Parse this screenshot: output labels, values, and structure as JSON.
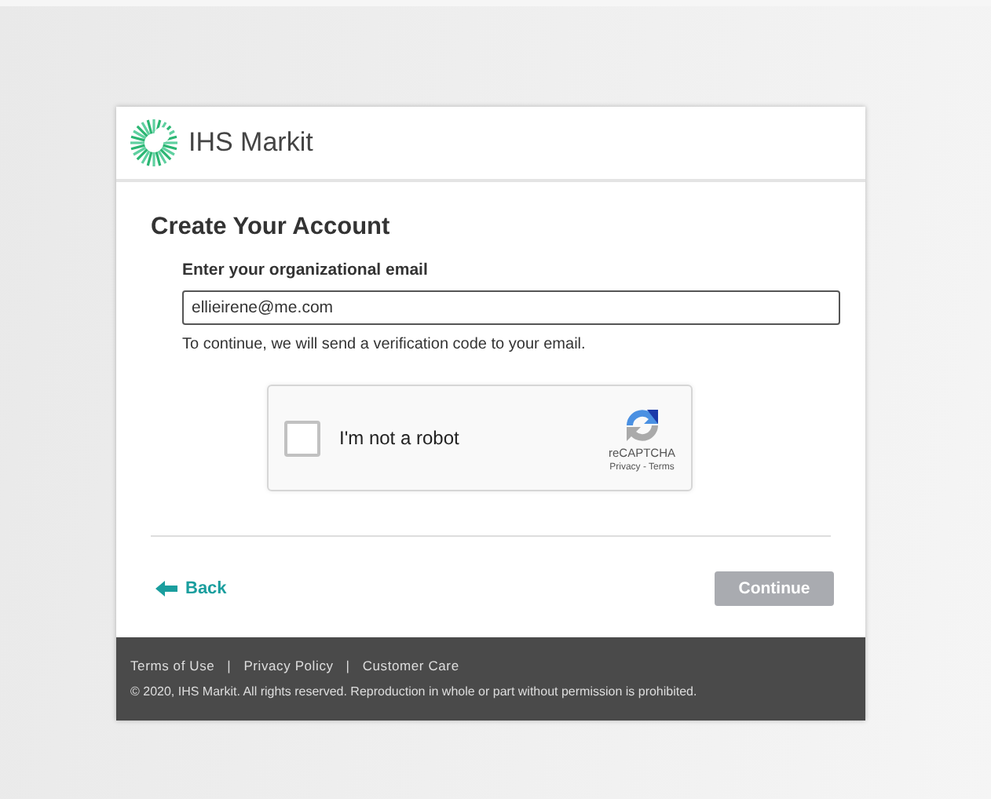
{
  "brand": {
    "name": "IHS Markit"
  },
  "form": {
    "title": "Create Your Account",
    "email_label": "Enter your organizational email",
    "email_value": "ellieirene@me.com",
    "note": "To continue, we will send a verification code to your email."
  },
  "captcha": {
    "label": "I'm not a robot",
    "checked": false,
    "brand": "reCAPTCHA",
    "links": "Privacy - Terms"
  },
  "actions": {
    "back": "Back",
    "continue": {
      "label": "Continue",
      "disabled": true
    }
  },
  "footer": {
    "links": [
      {
        "label": "Terms of Use"
      },
      {
        "label": "Privacy Policy"
      },
      {
        "label": "Customer Care"
      }
    ],
    "separator": "|",
    "copyright": "© 2020, IHS Markit. All rights reserved. Reproduction in whole or part without permission is prohibited."
  }
}
